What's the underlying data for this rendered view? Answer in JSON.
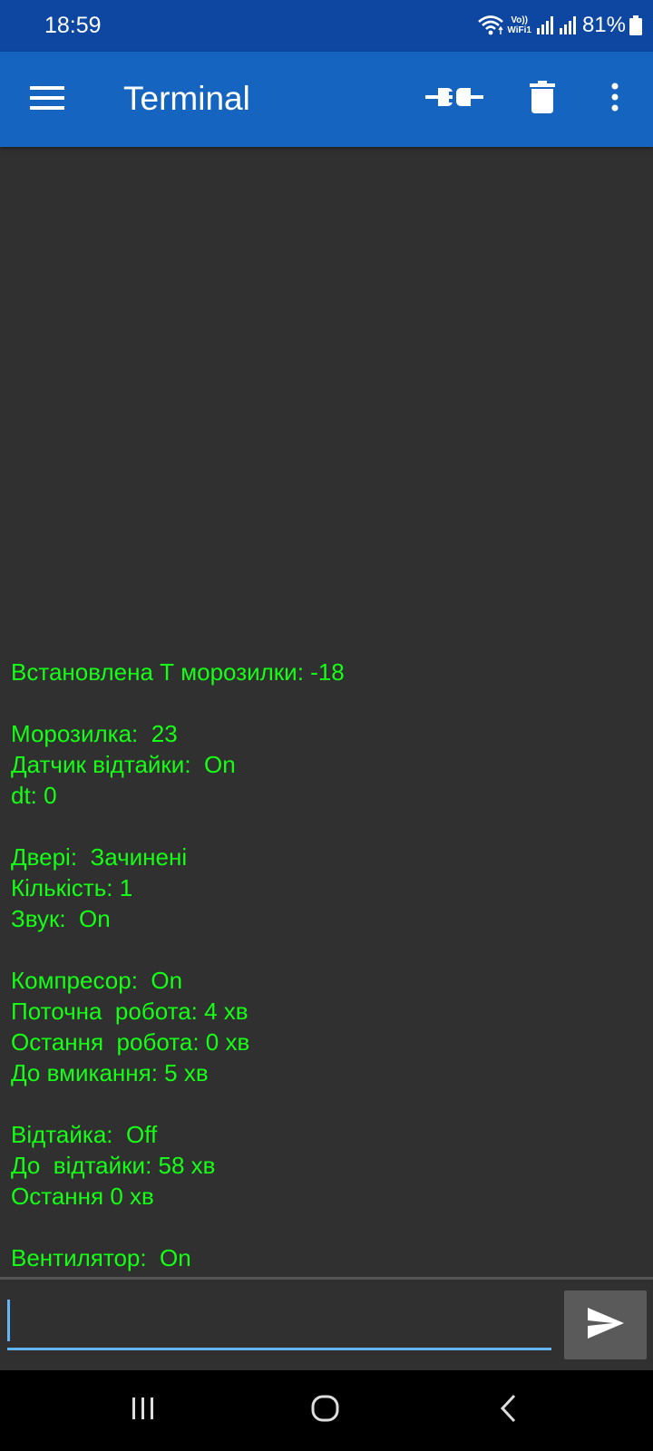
{
  "status_bar": {
    "time": "18:59",
    "battery_percent": "81%",
    "wifi_label_top": "Vo))",
    "wifi_label_bottom": "WiFi1",
    "icons": [
      "wifi-icon",
      "vowifi-icon",
      "signal-icon",
      "signal-icon",
      "battery-icon"
    ]
  },
  "app_bar": {
    "title": "Terminal",
    "icons": [
      "menu-icon",
      "connect-plug-icon",
      "trash-icon",
      "more-vert-icon"
    ]
  },
  "terminal": {
    "text_color": "#15ff15",
    "lines": [
      "Встановлена Т морозилки: -18",
      "",
      "Морозилка:  23",
      "Датчик відтайки:  On",
      "dt: 0",
      "",
      "Двері:  Зачинені",
      "Кількість: 1",
      "Звук:  On",
      "",
      "Компресор:  On",
      "Поточна  робота: 4 хв",
      "Остання  робота: 0 хв",
      "До вмикання: 5 хв",
      "",
      "Відтайка:  Off",
      "До  відтайки: 58 хв",
      "Остання 0 хв",
      "",
      "Вентилятор:  On"
    ]
  },
  "input": {
    "value": "",
    "send_icon": "send-icon"
  },
  "nav_bar": {
    "icons": [
      "recents-icon",
      "home-icon",
      "back-icon"
    ]
  },
  "colors": {
    "status_bar": "#0d47a1",
    "app_bar": "#1565c0",
    "background": "#303030",
    "accent": "#64b5f6"
  }
}
